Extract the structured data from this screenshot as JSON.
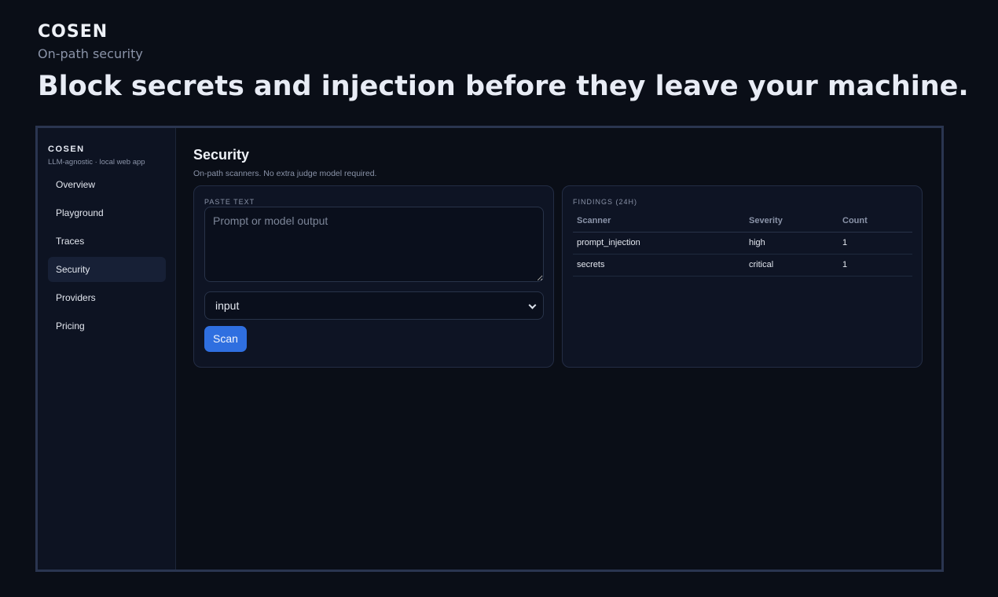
{
  "hero": {
    "brand": "COSEN",
    "tagline": "On-path security",
    "headline": "Block secrets and injection before they leave your machine."
  },
  "sidebar": {
    "brand": "COSEN",
    "subtitle": "LLM-agnostic · local web app",
    "items": [
      {
        "label": "Overview",
        "active": false
      },
      {
        "label": "Playground",
        "active": false
      },
      {
        "label": "Traces",
        "active": false
      },
      {
        "label": "Security",
        "active": true
      },
      {
        "label": "Providers",
        "active": false
      },
      {
        "label": "Pricing",
        "active": false
      }
    ]
  },
  "main": {
    "title": "Security",
    "subtitle": "On-path scanners. No extra judge model required."
  },
  "paste_card": {
    "label": "PASTE TEXT",
    "textarea_placeholder": "Prompt or model output",
    "textarea_value": "",
    "select_value": "input",
    "scan_label": "Scan"
  },
  "findings": {
    "label": "FINDINGS (24H)",
    "columns": [
      "Scanner",
      "Severity",
      "Count"
    ],
    "rows": [
      [
        "prompt_injection",
        "high",
        "1"
      ],
      [
        "secrets",
        "critical",
        "1"
      ]
    ]
  },
  "colors": {
    "background": "#0a0e17",
    "accent": "#2f6fe0",
    "active_nav": "#172036"
  }
}
